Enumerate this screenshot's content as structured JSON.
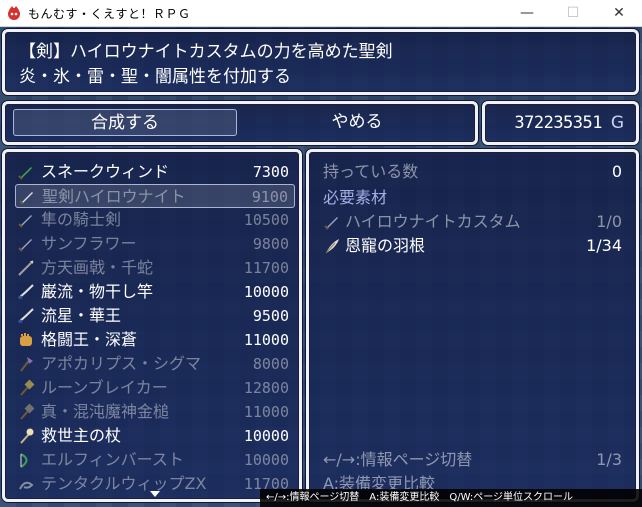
{
  "window": {
    "title": "もんむす・くえすと！ＲＰＧ",
    "minimize": "—",
    "maximize": "☐",
    "close": "✕"
  },
  "help": {
    "line1": "【剣】ハイロウナイトカスタムの力を高めた聖剣",
    "line2": "炎・氷・雷・聖・闇属性を付加する"
  },
  "commands": {
    "synthesize": "合成する",
    "cancel": "やめる"
  },
  "gold": {
    "value": "372235351",
    "unit": "G"
  },
  "items": [
    {
      "name": "スネークウィンド",
      "price": "7300",
      "icon": "sword-icon",
      "color": "#3fb04c",
      "dim": false
    },
    {
      "name": "聖剣ハイロウナイト",
      "price": "9100",
      "icon": "sword-icon",
      "color": "#d8dcf0",
      "dim": true
    },
    {
      "name": "隼の騎士剣",
      "price": "10500",
      "icon": "sword-icon",
      "color": "#9aa3b8",
      "dim": true
    },
    {
      "name": "サンフラワー",
      "price": "9800",
      "icon": "sword-icon",
      "color": "#9aa3b8",
      "dim": true
    },
    {
      "name": "方天画戟・千蛇",
      "price": "11700",
      "icon": "spear-icon",
      "color": "#a0a0a0",
      "dim": true
    },
    {
      "name": "巌流・物干し竿",
      "price": "10000",
      "icon": "katana-icon",
      "color": "#e0e0e0",
      "dim": false
    },
    {
      "name": "流星・華王",
      "price": "9500",
      "icon": "katana-icon",
      "color": "#e0e0e0",
      "dim": false
    },
    {
      "name": "格闘王・深蒼",
      "price": "11000",
      "icon": "fist-icon",
      "color": "#d8a040",
      "dim": false
    },
    {
      "name": "アポカリプス・シグマ",
      "price": "8000",
      "icon": "axe-icon",
      "color": "#8a6fb0",
      "dim": true
    },
    {
      "name": "ルーンブレイカー",
      "price": "12800",
      "icon": "hammer-icon",
      "color": "#9a8a50",
      "dim": true
    },
    {
      "name": "真・混沌魔神金槌",
      "price": "11000",
      "icon": "hammer-icon",
      "color": "#707070",
      "dim": true
    },
    {
      "name": "救世主の杖",
      "price": "10000",
      "icon": "staff-icon",
      "color": "#f0e0b0",
      "dim": false
    },
    {
      "name": "エルフィンバースト",
      "price": "10000",
      "icon": "bow-icon",
      "color": "#40a050",
      "dim": true
    },
    {
      "name": "テンタクルウィップZX",
      "price": "11700",
      "icon": "whip-icon",
      "color": "#8090a0",
      "dim": true
    }
  ],
  "detail": {
    "owned_label": "持っている数",
    "owned_value": "0",
    "materials_label": "必要素材",
    "materials": [
      {
        "name": "ハイロウナイトカスタム",
        "count": "1/0",
        "icon": "sword-icon",
        "dim": true
      },
      {
        "name": "恩寵の羽根",
        "count": "1/34",
        "icon": "feather-icon",
        "dim": false
      }
    ],
    "page_hint": "←/→:情報ページ切替",
    "page_no": "1/3",
    "compare_hint": "A:装備変更比較"
  },
  "status_bar": "←/→:情報ページ切替　A:装備変更比較　Q/W:ページ単位スクロール"
}
